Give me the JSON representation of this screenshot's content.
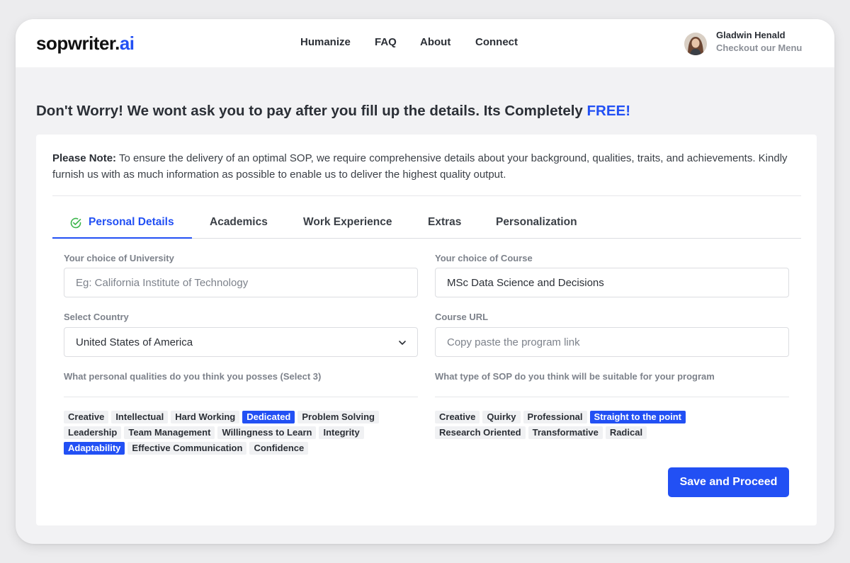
{
  "header": {
    "logo_main": "sopwriter.",
    "logo_accent": "ai",
    "nav": [
      "Humanize",
      "FAQ",
      "About",
      "Connect"
    ],
    "user": {
      "name": "Gladwin Henald",
      "subtitle": "Checkout our Menu"
    }
  },
  "headline": {
    "text": "Don't Worry! We wont ask you to pay after you fill up the details. Its Completely ",
    "highlight": "FREE!"
  },
  "note": {
    "bold": "Please Note:",
    "text": " To ensure the delivery of an optimal SOP, we require comprehensive details about your background, qualities, traits, and achievements. Kindly furnish us with as much information as possible to enable us to deliver the highest quality output."
  },
  "tabs": [
    "Personal Details",
    "Academics",
    "Work Experience",
    "Extras",
    "Personalization"
  ],
  "form": {
    "university": {
      "label": "Your choice of University",
      "placeholder": "Eg: California Institute of Technology",
      "value": ""
    },
    "course": {
      "label": "Your choice of Course",
      "placeholder": "",
      "value": "MSc Data Science and Decisions"
    },
    "country": {
      "label": "Select Country",
      "value": "United States of America"
    },
    "course_url": {
      "label": "Course URL",
      "placeholder": "Copy paste the program link",
      "value": ""
    },
    "qualities": {
      "label": "What personal qualities do you think you posses (Select 3)",
      "options": [
        "Creative",
        "Intellectual",
        "Hard Working",
        "Dedicated",
        "Problem Solving",
        "Leadership",
        "Team Management",
        "Willingness to Learn",
        "Integrity",
        "Adaptability",
        "Effective Communication",
        "Confidence"
      ],
      "selected": [
        "Dedicated",
        "Adaptability"
      ]
    },
    "sop_type": {
      "label": "What type of SOP do you think will be suitable for your program",
      "options": [
        "Creative",
        "Quirky",
        "Professional",
        "Straight to the point",
        "Research Oriented",
        "Transformative",
        "Radical"
      ],
      "selected": [
        "Straight to the point"
      ]
    }
  },
  "actions": {
    "save_label": "Save and Proceed"
  },
  "colors": {
    "accent": "#2250f4",
    "success": "#3bb54a",
    "text": "#2b2f36",
    "muted": "#7d828b"
  }
}
